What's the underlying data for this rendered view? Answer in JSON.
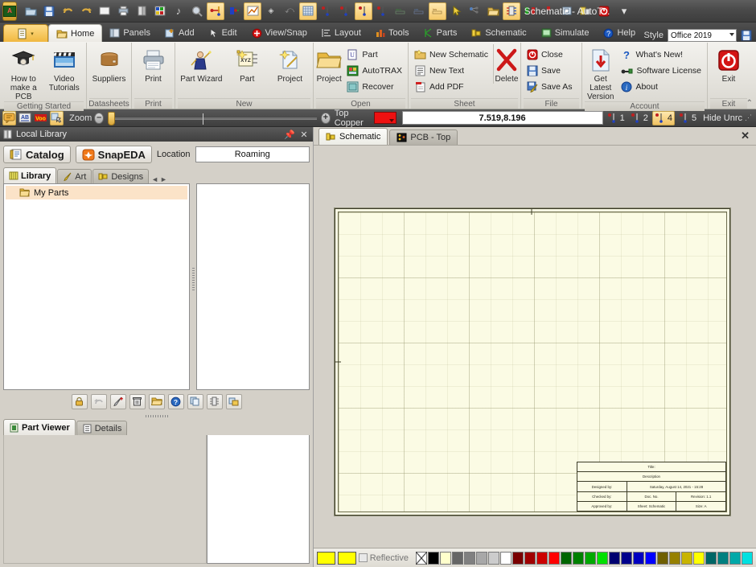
{
  "window": {
    "title": "Schematic - AutoT...",
    "minimize": "—",
    "maximize": "▭",
    "close": "✕",
    "restore_icon": "restore-icon",
    "qat_dropdown": "▾"
  },
  "quick_access": [
    {
      "name": "app-orb",
      "label": "A"
    },
    {
      "name": "open-folder-icon",
      "label": ""
    },
    {
      "name": "save-icon",
      "label": ""
    },
    {
      "name": "undo-icon",
      "label": "↶"
    },
    {
      "name": "redo-icon",
      "label": "↷"
    },
    {
      "name": "new-sheet-icon",
      "label": ""
    },
    {
      "name": "print-icon",
      "label": ""
    },
    {
      "name": "layers-icon",
      "label": ""
    },
    {
      "name": "color-icon",
      "label": ""
    },
    {
      "name": "note-icon",
      "label": "♪"
    },
    {
      "name": "zoom-icon",
      "label": ""
    },
    {
      "name": "measure-horizontal-icon",
      "label": ""
    },
    {
      "name": "measure-block-icon",
      "label": ""
    },
    {
      "name": "graph-icon",
      "label": ""
    },
    {
      "name": "dot-icon",
      "label": "•"
    },
    {
      "name": "arrow-icon",
      "label": "⤺"
    },
    {
      "name": "grid-icon",
      "label": ""
    },
    {
      "name": "dim-1-icon",
      "label": ""
    },
    {
      "name": "dim-2-icon",
      "label": ""
    },
    {
      "name": "dim-3-icon",
      "label": ""
    },
    {
      "name": "dim-4-icon",
      "label": ""
    },
    {
      "name": "dim-5-icon",
      "label": ""
    },
    {
      "name": "dim-6-icon",
      "label": ""
    },
    {
      "name": "ins-icon",
      "label": ""
    },
    {
      "name": "pointer-icon",
      "label": ""
    },
    {
      "name": "net-icon",
      "label": ""
    },
    {
      "name": "folder-open-icon",
      "label": ""
    },
    {
      "name": "component-icon",
      "label": ""
    },
    {
      "name": "mirror-icon",
      "label": ""
    },
    {
      "name": "pin-red-icon",
      "label": ""
    },
    {
      "name": "cube-icon",
      "label": ""
    },
    {
      "name": "chip-icon",
      "label": ""
    },
    {
      "name": "power-red-icon",
      "label": ""
    }
  ],
  "ribbon": {
    "app_button_label": "",
    "tabs": [
      {
        "label": "Home",
        "icon": "home-folder-icon",
        "active": true
      },
      {
        "label": "Panels",
        "icon": "panels-icon",
        "active": false
      },
      {
        "label": "Add",
        "icon": "add-icon",
        "active": false
      },
      {
        "label": "Edit",
        "icon": "edit-cursor-icon",
        "active": false
      },
      {
        "label": "View/Snap",
        "icon": "view-snap-icon",
        "active": false
      },
      {
        "label": "Layout",
        "icon": "layout-icon",
        "active": false
      },
      {
        "label": "Tools",
        "icon": "tools-icon",
        "active": false
      },
      {
        "label": "Parts",
        "icon": "parts-icon",
        "active": false
      },
      {
        "label": "Schematic",
        "icon": "schematic-icon",
        "active": false
      },
      {
        "label": "Simulate",
        "icon": "simulate-icon",
        "active": false
      },
      {
        "label": "Help",
        "icon": "help-icon",
        "active": false
      }
    ],
    "style_label": "Style",
    "style_value": "Office 2019",
    "style_save_icon": "save-style-icon",
    "collapse_icon": "collapse-ribbon-icon",
    "groups": [
      {
        "title": "Getting Started",
        "dialog_launcher": false,
        "big_buttons": [
          {
            "label": "How to\nmake a PCB",
            "line1": "How to",
            "line2": "make a PCB",
            "icon": "graduation-cap-icon"
          },
          {
            "label": "Video Tutorials",
            "line1": "Video",
            "line2": "Tutorials",
            "icon": "video-clapper-icon"
          }
        ]
      },
      {
        "title": "Datasheets",
        "dialog_launcher": false,
        "big_buttons": [
          {
            "line1": "Suppliers",
            "line2": "",
            "icon": "package-box-icon"
          }
        ]
      },
      {
        "title": "Print",
        "dialog_launcher": false,
        "big_buttons": [
          {
            "line1": "Print",
            "line2": "",
            "icon": "printer-icon"
          }
        ]
      },
      {
        "title": "New",
        "dialog_launcher": true,
        "big_buttons": [
          {
            "line1": "Part Wizard",
            "line2": "",
            "icon": "wizard-icon"
          },
          {
            "line1": "Part",
            "line2": "",
            "icon": "part-xyz-icon"
          },
          {
            "line1": "Project",
            "line2": "",
            "icon": "new-project-icon"
          }
        ]
      },
      {
        "title": "Open",
        "dialog_launcher": true,
        "big_buttons": [
          {
            "line1": "Project",
            "line2": "",
            "icon": "open-folder-icon"
          }
        ],
        "small_buttons": [
          {
            "label": "Part",
            "icon": "open-part-icon"
          },
          {
            "label": "AutoTRAX",
            "icon": "autotrax-icon"
          },
          {
            "label": "Recover",
            "icon": "recover-icon"
          }
        ]
      },
      {
        "title": "Sheet",
        "dialog_launcher": false,
        "small_buttons": [
          {
            "label": "New Schematic",
            "icon": "new-schematic-icon"
          },
          {
            "label": "New Text",
            "icon": "new-text-icon"
          },
          {
            "label": "Add PDF",
            "icon": "add-pdf-icon"
          }
        ],
        "big_buttons_after": [
          {
            "line1": "Delete",
            "line2": "",
            "icon": "delete-x-icon"
          }
        ]
      },
      {
        "title": "File",
        "dialog_launcher": true,
        "small_buttons": [
          {
            "label": "Close",
            "icon": "close-red-icon"
          },
          {
            "label": "Save",
            "icon": "save-blue-icon"
          },
          {
            "label": "Save As",
            "icon": "save-as-icon"
          }
        ]
      },
      {
        "title": "Account",
        "dialog_launcher": false,
        "big_buttons": [
          {
            "line1": "Get Latest",
            "line2": "Version",
            "icon": "download-icon"
          }
        ],
        "small_buttons": [
          {
            "label": "What's New!",
            "icon": "question-icon"
          },
          {
            "label": "Software License",
            "icon": "key-icon"
          },
          {
            "label": "About",
            "icon": "info-icon"
          }
        ]
      },
      {
        "title": "Exit",
        "dialog_launcher": false,
        "big_buttons": [
          {
            "line1": "Exit",
            "line2": "",
            "icon": "exit-power-icon"
          }
        ]
      }
    ]
  },
  "toolbar2": {
    "icons": [
      {
        "name": "comment-icon",
        "highlight": true
      },
      {
        "name": "ab-text-icon",
        "highlight": false
      },
      {
        "name": "voo-icon",
        "highlight": false
      },
      {
        "name": "drag-hand-icon",
        "highlight": true
      }
    ],
    "zoom_label": "Zoom",
    "zoom_minus": "–",
    "zoom_plus": "+",
    "zoom_value": 2,
    "layer_label": "Top Copper",
    "layer_color": "#ee1111",
    "coordinates": "7.519,8.196",
    "layer_buttons": [
      {
        "label": "1",
        "active": false
      },
      {
        "label": "2",
        "active": false
      },
      {
        "label": "4",
        "active": true
      },
      {
        "label": "5",
        "active": false
      }
    ],
    "hide_unrouted": "Hide Unrc"
  },
  "local_library": {
    "caption": "Local Library",
    "caption_icon": "library-icon",
    "pin_icon": "pin-icon",
    "close_icon": "close-icon",
    "catalog_button": "Catalog",
    "catalog_icon": "catalog-icon",
    "snapeda_button": "SnapEDA",
    "snapeda_icon": "snapeda-icon",
    "location_label": "Location",
    "location_value": "Roaming",
    "tabs": [
      {
        "label": "Library",
        "icon": "library-tab-icon",
        "active": true
      },
      {
        "label": "Art",
        "icon": "art-pencil-icon",
        "active": false
      },
      {
        "label": "Designs",
        "icon": "designs-icon",
        "active": false
      }
    ],
    "tab_nav_prev": "◄",
    "tab_nav_next": "►",
    "tree_items": [
      {
        "label": "My Parts",
        "icon": "folder-icon",
        "selected": true
      }
    ],
    "toolbar_buttons": [
      {
        "name": "lock-button",
        "icon": "lock-icon"
      },
      {
        "name": "undo-button",
        "icon": "undo-icon"
      },
      {
        "name": "edit-add-button",
        "icon": "pencil-plus-icon"
      },
      {
        "name": "delete-button",
        "icon": "trash-icon"
      },
      {
        "name": "open-button",
        "icon": "folder-open-icon"
      },
      {
        "name": "help-button",
        "icon": "help-blue-icon"
      },
      {
        "name": "copy-button",
        "icon": "copy-icon"
      },
      {
        "name": "chip-button",
        "icon": "chip-icon"
      },
      {
        "name": "export-button",
        "icon": "export-icon"
      }
    ]
  },
  "part_viewer": {
    "tabs": [
      {
        "label": "Part Viewer",
        "icon": "part-viewer-icon",
        "active": true
      },
      {
        "label": "Details",
        "icon": "details-icon",
        "active": false
      }
    ]
  },
  "document": {
    "tabs": [
      {
        "label": "Schematic",
        "icon": "schematic-tab-icon",
        "active": true
      },
      {
        "label": "PCB - Top",
        "icon": "pcb-tab-icon",
        "active": false
      }
    ],
    "close_label": "✕"
  },
  "title_block": {
    "rows": [
      [
        {
          "text": "Title:",
          "flex": 1
        }
      ],
      [
        {
          "text": "Description",
          "flex": 1
        }
      ],
      [
        {
          "text": "Designed by:",
          "flex": 1
        },
        {
          "text": "Saturday, August 14, 2021 - 15:28",
          "flex": 2
        }
      ],
      [
        {
          "text": "Checked by:",
          "flex": 1
        },
        {
          "text": "Doc. No.",
          "flex": 1
        },
        {
          "text": "Revision: 1.1",
          "flex": 1
        }
      ],
      [
        {
          "text": "Approved by:",
          "flex": 1
        },
        {
          "text": "Sheet: Schematic",
          "flex": 1
        },
        {
          "text": "Size: A",
          "flex": 1
        }
      ]
    ]
  },
  "colorbar": {
    "swatch1": "#ffff00",
    "swatch2": "#ffff00",
    "reflective_label": "Reflective",
    "reflective_checked": false,
    "palette": [
      "none",
      "#000000",
      "#ffffcc",
      "#666666",
      "#808080",
      "#a8a8a8",
      "#cccccc",
      "#ffffff",
      "#7a0000",
      "#a00000",
      "#cc0000",
      "#ff0000",
      "#006600",
      "#008000",
      "#00a800",
      "#00e000",
      "#000070",
      "#00008c",
      "#0000c0",
      "#0000ff",
      "#706000",
      "#968000",
      "#c8b400",
      "#ffff00",
      "#006666",
      "#008080",
      "#00a8a8",
      "#00e0e0"
    ]
  }
}
